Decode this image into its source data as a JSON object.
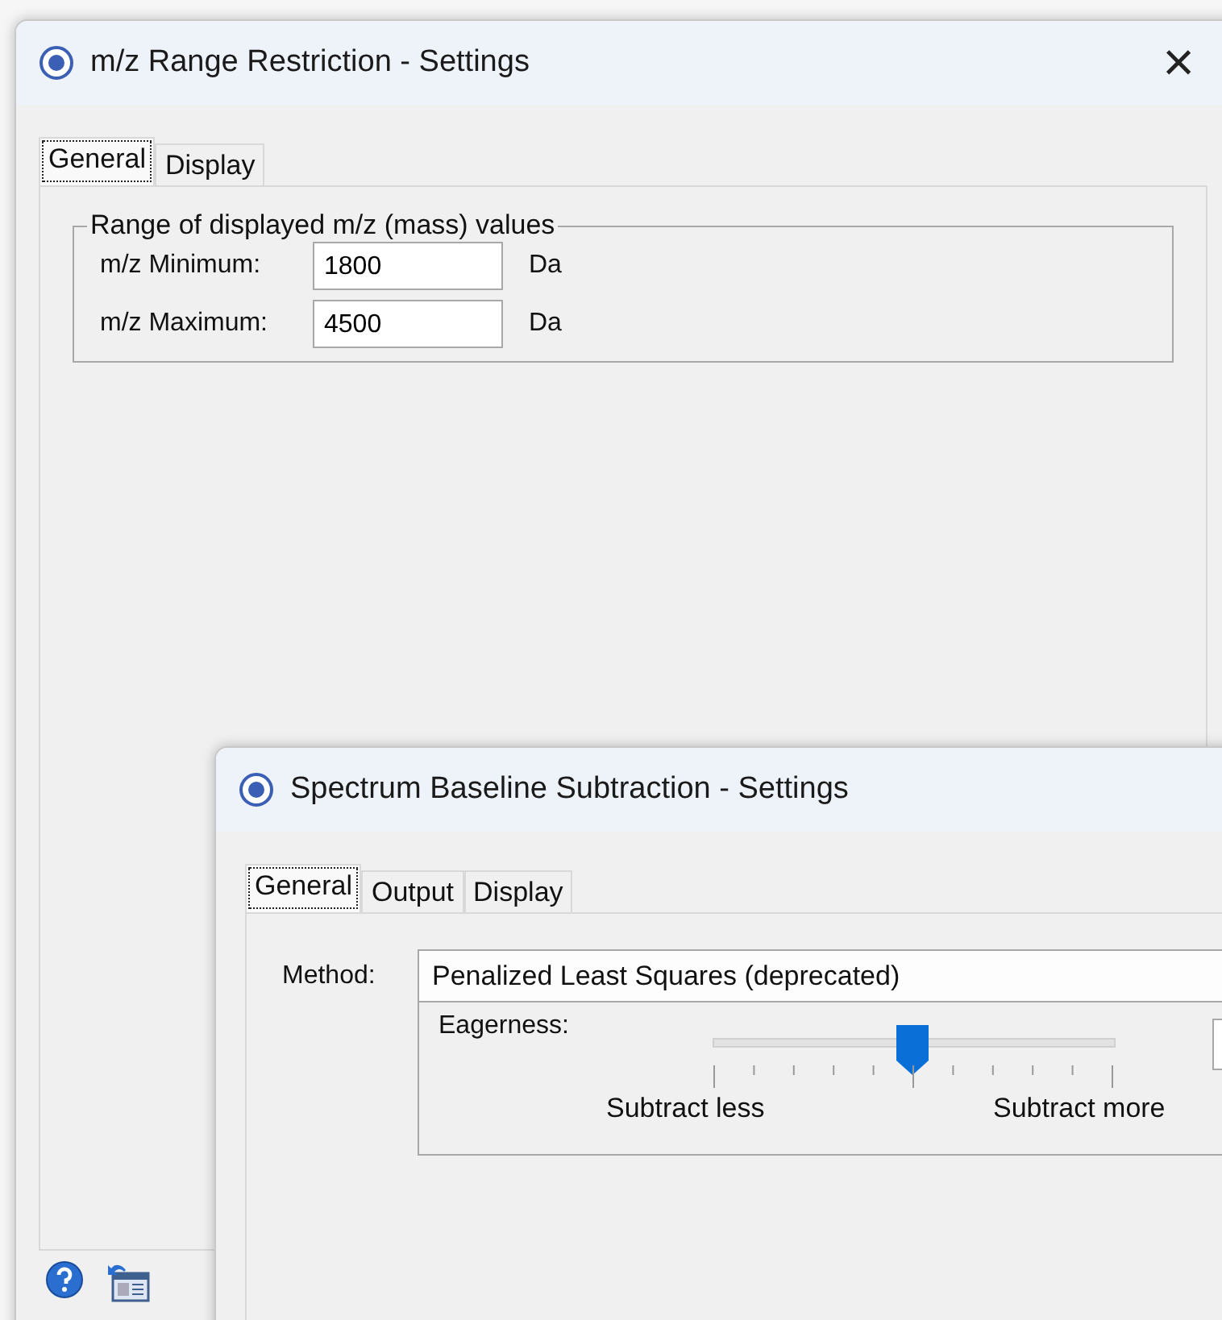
{
  "windows": [
    {
      "title": "m/z Range Restriction - Settings",
      "close": "×",
      "tabs": [
        {
          "label": "General",
          "selected": true
        },
        {
          "label": "Display",
          "selected": false
        }
      ],
      "group": {
        "title": "Range of displayed m/z (mass) values",
        "fields": [
          {
            "label": "m/z Minimum:",
            "value": "1800",
            "unit": "Da"
          },
          {
            "label": "m/z Maximum:",
            "value": "4500",
            "unit": "Da"
          }
        ]
      }
    },
    {
      "title": "Spectrum Baseline Subtraction - Settings",
      "tabs": [
        {
          "label": "General",
          "selected": true
        },
        {
          "label": "Output",
          "selected": false
        },
        {
          "label": "Display",
          "selected": false
        }
      ],
      "method": {
        "label": "Method:",
        "value": "Penalized Least Squares (deprecated)"
      },
      "eagerness": {
        "label": "Eagerness:",
        "level": 0.5,
        "min_label": "Subtract less",
        "max_label": "Subtract more"
      }
    }
  ]
}
